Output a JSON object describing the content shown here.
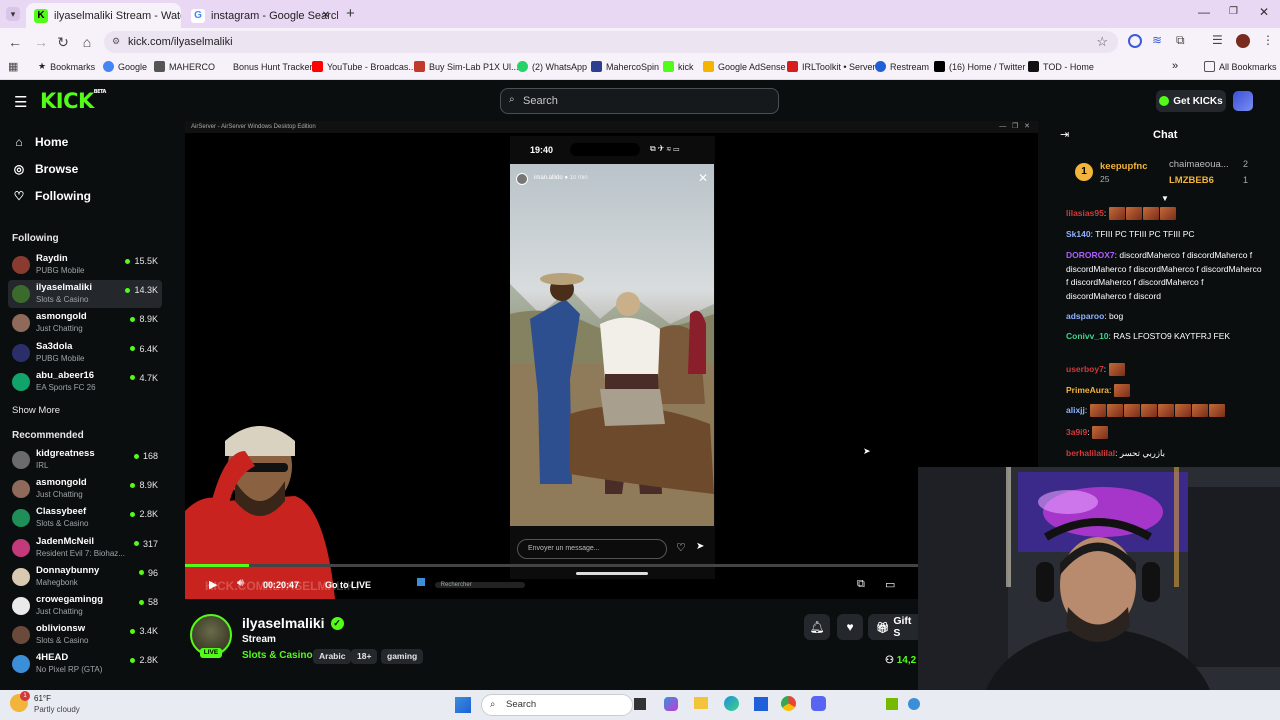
{
  "browser": {
    "tabs": [
      {
        "title": "ilyaselmaliki Stream - Watc",
        "active": true
      },
      {
        "title": "instagram - Google Search",
        "active": false
      }
    ],
    "url": "kick.com/ilyaselmaliki",
    "bookmarks": [
      {
        "label": "Bookmarks",
        "icon": "star-icon"
      },
      {
        "label": "Google",
        "icon": "google-icon"
      },
      {
        "label": "MAHERCO",
        "icon": "maherco-icon"
      },
      {
        "label": "Bonus Hunt Tracker",
        "icon": "tracker-icon"
      },
      {
        "label": "YouTube - Broadcas...",
        "icon": "youtube-icon"
      },
      {
        "label": "Buy Sim-Lab P1X Ul...",
        "icon": "simlab-icon"
      },
      {
        "label": "(2) WhatsApp",
        "icon": "whatsapp-icon"
      },
      {
        "label": "MahercoSpin",
        "icon": "mahercospin-icon"
      },
      {
        "label": "kick",
        "icon": "kick-icon"
      },
      {
        "label": "Google AdSense",
        "icon": "adsense-icon"
      },
      {
        "label": "IRLToolkit • Server",
        "icon": "irltoolkit-icon"
      },
      {
        "label": "Restream",
        "icon": "restream-icon"
      },
      {
        "label": "(16) Home / Twitter",
        "icon": "x-icon"
      },
      {
        "label": "TOD - Home",
        "icon": "tod-icon"
      }
    ],
    "all_bookmarks": "All Bookmarks"
  },
  "header": {
    "logo": "KICK",
    "logo_badge": "BETA",
    "search_placeholder": "Search",
    "get_kicks": "Get KICKs"
  },
  "sidebar": {
    "nav": [
      {
        "label": "Home",
        "icon": "home-icon"
      },
      {
        "label": "Browse",
        "icon": "compass-icon"
      },
      {
        "label": "Following",
        "icon": "heart-icon"
      }
    ],
    "following_title": "Following",
    "following": [
      {
        "name": "Raydin",
        "category": "PUBG Mobile",
        "viewers": "15.5K",
        "color": "#8a3b2f"
      },
      {
        "name": "ilyaselmaliki",
        "category": "Slots & Casino",
        "viewers": "14.3K",
        "color": "#3a6b2d"
      },
      {
        "name": "asmongold",
        "category": "Just Chatting",
        "viewers": "8.9K",
        "color": "#8f6a5a"
      },
      {
        "name": "Sa3dola",
        "category": "PUBG Mobile",
        "viewers": "6.4K",
        "color": "#2a2f6a"
      },
      {
        "name": "abu_abeer16",
        "category": "EA Sports FC 26",
        "viewers": "4.7K",
        "color": "#10a36a"
      }
    ],
    "show_more": "Show More",
    "recommended_title": "Recommended",
    "recommended": [
      {
        "name": "kidgreatness",
        "category": "IRL",
        "viewers": "168",
        "color": "#6b6b6b"
      },
      {
        "name": "asmongold",
        "category": "Just Chatting",
        "viewers": "8.9K",
        "color": "#8f6a5a"
      },
      {
        "name": "Classybeef",
        "category": "Slots & Casino",
        "viewers": "2.8K",
        "color": "#1f8f5a"
      },
      {
        "name": "JadenMcNeil",
        "category": "Resident Evil 7: Biohaz...",
        "viewers": "317",
        "color": "#c23a7a"
      },
      {
        "name": "Donnaybunny",
        "category": "Mahegbonk",
        "viewers": "96",
        "color": "#d9c9b0"
      },
      {
        "name": "crowegamingg",
        "category": "Just Chatting",
        "viewers": "58",
        "color": "#eaeaea"
      },
      {
        "name": "oblivionsw",
        "category": "Slots & Casino",
        "viewers": "3.4K",
        "color": "#6a4a3a"
      },
      {
        "name": "4HEAD",
        "category": "No Pixel RP (GTA)",
        "viewers": "2.8K",
        "color": "#3b8fd9"
      }
    ]
  },
  "video": {
    "airserver_title": "AirServer - AirServer Windows Desktop Edition",
    "phone_time": "19:40",
    "story_user": "iman.allido",
    "story_time": "10 min",
    "message_placeholder": "Envoyer un message...",
    "elapsed": "00:20:47",
    "go_live": "Go to LIVE",
    "watermark": "KICK.COM/ILYASELMALIKI",
    "taskbar_search": "Rechercher",
    "progress_fraction": 0.087
  },
  "channel": {
    "name": "ilyaselmaliki",
    "title": "Stream",
    "category": "Slots & Casino",
    "tags": [
      "Arabic",
      "18+",
      "gaming"
    ],
    "live_badge": "LIVE",
    "gift_label": "Gift S",
    "viewers": "14,2"
  },
  "chat": {
    "title": "Chat",
    "pinned": [
      {
        "name": "keepupfnc",
        "count": "25"
      },
      {
        "name": "chaimaeoua...",
        "count": "2"
      },
      {
        "name": "LMZBEB6",
        "count": "1"
      }
    ],
    "messages": [
      {
        "user": "lilasias95",
        "color": "#d23a3a",
        "text": "",
        "emotes": 4
      },
      {
        "user": "Sk140",
        "color": "#8fb3ff",
        "text": "TFIII PC TFIII PC TFIII PC",
        "emotes": 0
      },
      {
        "user": "DOROROX7",
        "color": "#b05cff",
        "text": "discordMaherco f discordMaherco f discordMaherco f discordMaherco f discordMaherco f discordMaherco f discordMaherco f discordMaherco f discord",
        "emotes": 0
      },
      {
        "user": "adsparoo",
        "color": "#8fb3ff",
        "text": "bog",
        "emotes": 0
      },
      {
        "user": "Conivv_10",
        "color": "#3fd38a",
        "text": "RAS LFOSTO9 KAYTFRJ FEK",
        "emotes": 0
      },
      {
        "user": "userboy7",
        "color": "#d23a3a",
        "text": "",
        "emotes": 1
      },
      {
        "user": "PrimeAura",
        "color": "#f2b43a",
        "text": "",
        "emotes": 1
      },
      {
        "user": "alixjj",
        "color": "#8fb3ff",
        "text": "",
        "emotes": 8
      },
      {
        "user": "3a9i9",
        "color": "#d23a3a",
        "text": "",
        "emotes": 1
      },
      {
        "user": "berhalilalilal",
        "color": "#d23a3a",
        "text": "بازربي تحسر",
        "emotes": 0
      }
    ]
  },
  "taskbar": {
    "temp": "61°F",
    "weather": "Partly cloudy",
    "search": "Search",
    "notification_count": "1"
  },
  "colors": {
    "kick_green": "#53fc18",
    "bg": "#0b0e0f",
    "panel": "#24272c"
  }
}
